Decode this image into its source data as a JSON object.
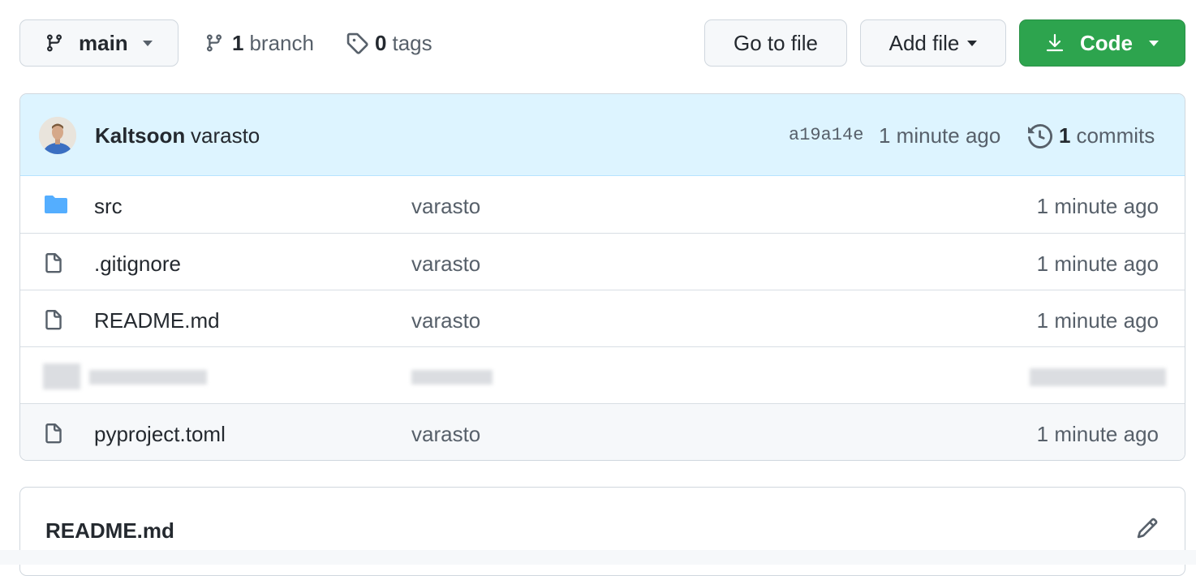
{
  "toolbar": {
    "branch_select": "main",
    "branches": {
      "count": "1",
      "label": "branch"
    },
    "tags": {
      "count": "0",
      "label": "tags"
    },
    "goto_file": "Go to file",
    "add_file": "Add file",
    "code": "Code"
  },
  "commit": {
    "author": "Kaltsoon",
    "message": "varasto",
    "sha": "a19a14e",
    "time": "1 minute ago",
    "count": "1",
    "count_label": "commits"
  },
  "files": [
    {
      "icon": "folder-icon",
      "name": "src",
      "message": "varasto",
      "time": "1 minute ago",
      "redacted": false
    },
    {
      "icon": "file-icon",
      "name": ".gitignore",
      "message": "varasto",
      "time": "1 minute ago",
      "redacted": false
    },
    {
      "icon": "file-icon",
      "name": "README.md",
      "message": "varasto",
      "time": "1 minute ago",
      "redacted": false
    },
    {
      "icon": "file-icon",
      "name": "",
      "message": "",
      "time": "",
      "redacted": true
    },
    {
      "icon": "file-icon",
      "name": "pyproject.toml",
      "message": "varasto",
      "time": "1 minute ago",
      "redacted": false
    }
  ],
  "readme": {
    "title": "README.md"
  },
  "colors": {
    "accent_green": "#2da44e",
    "commit_bar_bg": "#ddf4ff",
    "folder_blue": "#54aeff"
  }
}
